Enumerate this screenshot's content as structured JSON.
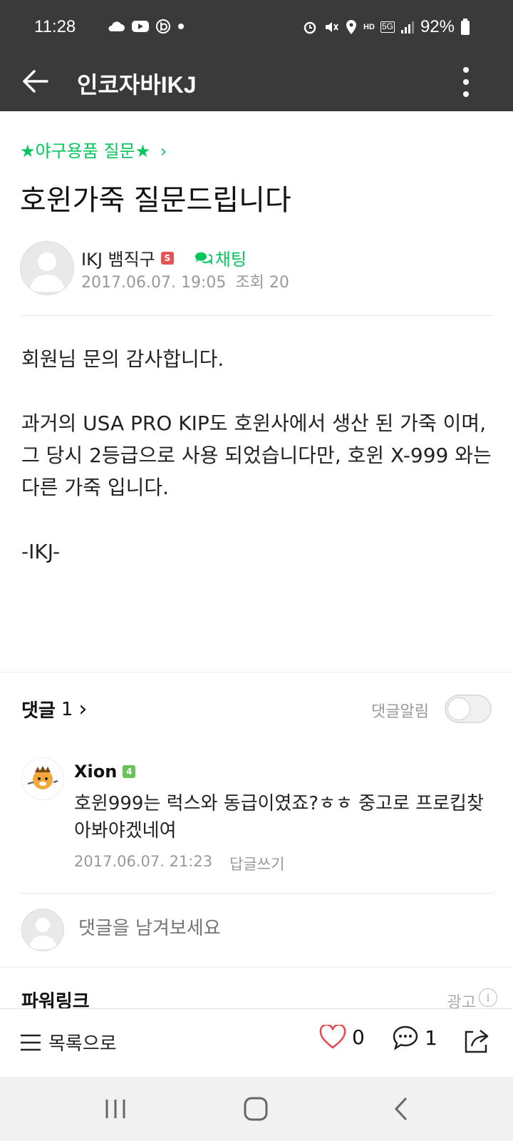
{
  "status_bar": {
    "time": "11:28",
    "battery": "92%",
    "hd_label": "HD",
    "network": "5G"
  },
  "app_bar": {
    "title": "인코자바IKJ"
  },
  "post": {
    "category": "★야구용품 질문★",
    "title": "호윈가죽 질문드립니다",
    "author": "IKJ 뱀직구",
    "author_badge": "S",
    "chat_label": "채팅",
    "date": "2017.06.07. 19:05",
    "views": "조회 20",
    "body": "회원님 문의 감사합니다.\n\n과거의 USA PRO KIP도 호윈사에서 생산 된 가죽 이며,\n그 당시 2등급으로 사용 되었습니다만, 호윈 X-999 와는 다른 가죽 입니다.\n\n-IKJ-"
  },
  "comments": {
    "label": "댓글",
    "count": "1",
    "notify_label": "댓글알림",
    "notify_on": false,
    "items": [
      {
        "author": "Xion",
        "badge": "4",
        "text": "호윈999는 럭스와 동급이였죠?ㅎㅎ 중고로 프로킵찾아봐야겠네여",
        "date": "2017.06.07. 21:23",
        "reply_label": "답글쓰기"
      }
    ],
    "input_placeholder": "댓글을 남겨보세요"
  },
  "powerlink": {
    "title": "파워링크",
    "ad_label": "광고",
    "info_icon": "i"
  },
  "bottom_bar": {
    "list_label": "목록으로",
    "likes": "0",
    "comment_count": "1"
  },
  "colors": {
    "accent_green": "#03c75a",
    "header_bg": "#3a3a3a",
    "like_red": "#e8474f"
  }
}
